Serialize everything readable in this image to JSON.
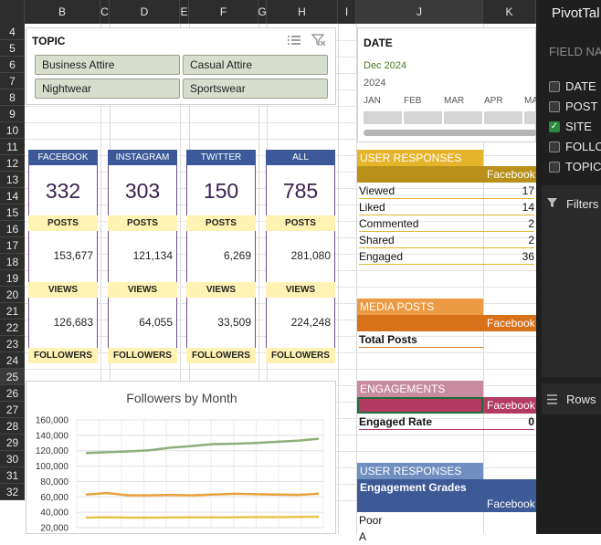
{
  "columns": [
    "B",
    "C",
    "D",
    "E",
    "F",
    "G",
    "H",
    "I",
    "J",
    "K"
  ],
  "rows": [
    "4",
    "5",
    "6",
    "7",
    "8",
    "9",
    "10",
    "11",
    "12",
    "13",
    "14",
    "15",
    "16",
    "17",
    "18",
    "19",
    "20",
    "21",
    "22",
    "23",
    "24",
    "25",
    "26",
    "27",
    "28",
    "29",
    "30",
    "31",
    "32"
  ],
  "topic_slicer": {
    "title": "TOPIC",
    "buttons": [
      "Business Attire",
      "Casual Attire",
      "Nightwear",
      "Sportswear"
    ]
  },
  "cards": [
    {
      "site": "FACEBOOK",
      "posts_count": "332",
      "posts_label": "POSTS",
      "views": "153,677",
      "views_label": "VIEWS",
      "followers": "126,683",
      "followers_label": "FOLLOWERS"
    },
    {
      "site": "INSTAGRAM",
      "posts_count": "303",
      "posts_label": "POSTS",
      "views": "121,134",
      "views_label": "VIEWS",
      "followers": "64,055",
      "followers_label": "FOLLOWERS"
    },
    {
      "site": "TWITTER",
      "posts_count": "150",
      "posts_label": "POSTS",
      "views": "6,269",
      "views_label": "VIEWS",
      "followers": "33,509",
      "followers_label": "FOLLOWERS"
    },
    {
      "site": "ALL",
      "posts_count": "785",
      "posts_label": "POSTS",
      "views": "281,080",
      "views_label": "VIEWS",
      "followers": "224,248",
      "followers_label": "FOLLOWERS"
    }
  ],
  "chart_data": {
    "type": "line",
    "title": "Followers by Month",
    "ylim": [
      20000,
      160000
    ],
    "yticks": [
      "160,000",
      "140,000",
      "120,000",
      "100,000",
      "80,000",
      "60,000",
      "40,000",
      "20,000"
    ],
    "x": [
      1,
      2,
      3,
      4,
      5,
      6,
      7,
      8,
      9,
      10,
      11,
      12
    ],
    "series": [
      {
        "color": "#8fae7a",
        "values": [
          117000,
          118000,
          119000,
          120500,
          124000,
          126000,
          128500,
          129000,
          130000,
          131500,
          133000,
          135500
        ]
      },
      {
        "color": "#e8a13a",
        "values": [
          63000,
          65000,
          62000,
          62000,
          62500,
          62000,
          63000,
          64000,
          63500,
          63000,
          62500,
          64000
        ]
      },
      {
        "color": "#e7c34a",
        "values": [
          33000,
          33500,
          33000,
          33000,
          33200,
          33300,
          33400,
          33500,
          33600,
          33700,
          34000,
          34200
        ]
      }
    ]
  },
  "date_slicer": {
    "title": "DATE",
    "period": "Dec 2024",
    "year": "2024",
    "months": [
      "JAN",
      "FEB",
      "MAR",
      "APR",
      "MA"
    ]
  },
  "user_responses": {
    "title": "USER RESPONSES",
    "col": "Facebook",
    "rows": [
      {
        "label": "Viewed",
        "value": "17"
      },
      {
        "label": "Liked",
        "value": "14"
      },
      {
        "label": "Commented",
        "value": "2"
      },
      {
        "label": "Shared",
        "value": "2"
      },
      {
        "label": "Engaged",
        "value": "36"
      }
    ]
  },
  "media_posts": {
    "title": "MEDIA POSTS",
    "col": "Facebook",
    "row_label": "Total Posts"
  },
  "engagements": {
    "title": "ENGAGEMENTS",
    "col": "Facebook",
    "row_label": "Engaged Rate",
    "row_value": "0"
  },
  "user_responses2": {
    "title": "USER RESPONSES",
    "subtitle": "Engagement Grades",
    "col": "Facebook",
    "row_label": "Poor",
    "row2_label": "A"
  },
  "pivot_panel": {
    "title": "PivotTal",
    "field_label": "FIELD NA",
    "fields": [
      {
        "name": "DATE",
        "checked": false
      },
      {
        "name": "POST",
        "checked": false
      },
      {
        "name": "SITE",
        "checked": true
      },
      {
        "name": "FOLLO",
        "checked": false
      },
      {
        "name": "TOPIC",
        "checked": false
      }
    ],
    "filters_label": "Filters",
    "rows_label": "Rows"
  }
}
